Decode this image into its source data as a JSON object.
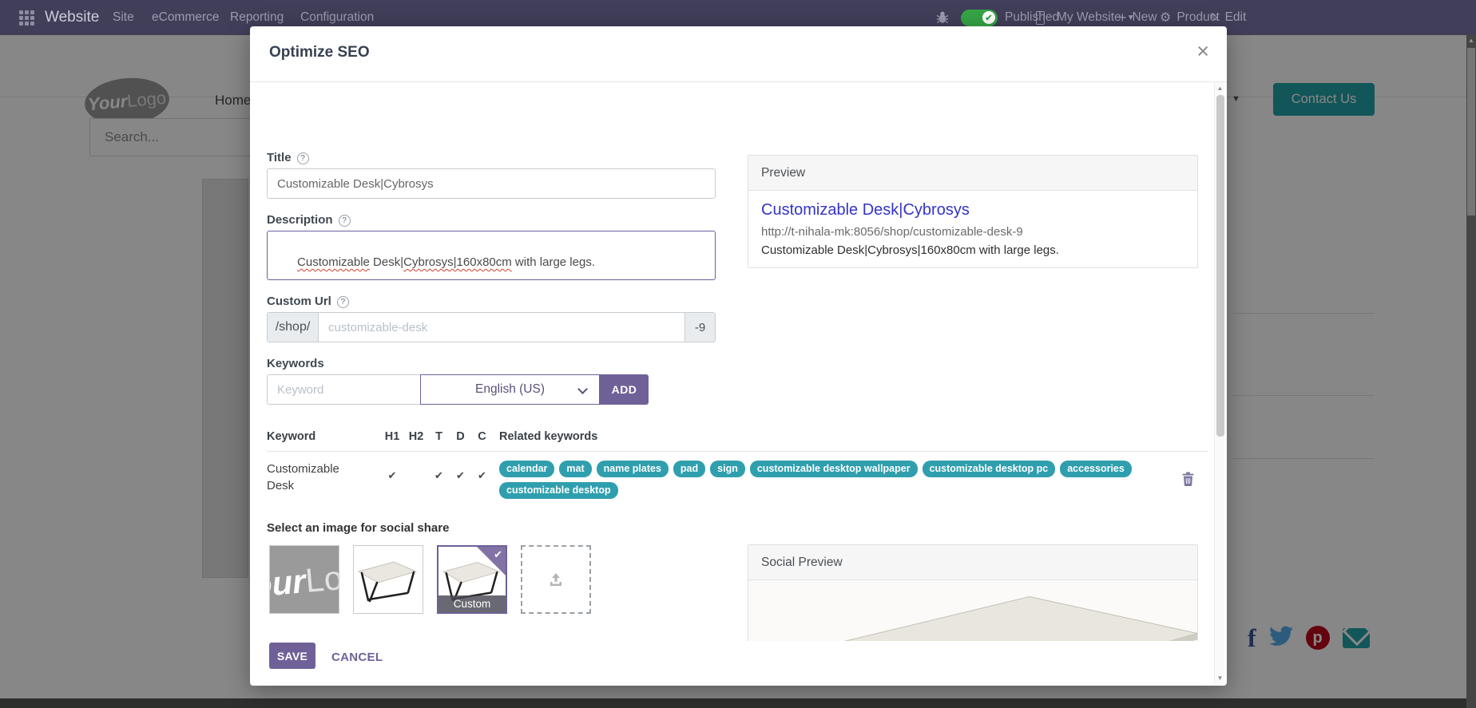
{
  "topbar": {
    "brand": "Website",
    "menus": [
      "Site",
      "eCommerce",
      "Reporting",
      "Configuration"
    ],
    "published_label": "Published",
    "website_selector": "My Website",
    "new_label": "New",
    "product_label": "Product",
    "edit_label": "Edit",
    "plus_glyph": "+",
    "gear_glyph": "⚙",
    "pencil_glyph": "✎",
    "caret_glyph": "▼"
  },
  "page_background": {
    "logo_part1": "Your",
    "logo_part2": "Logo",
    "nav_home": "Home",
    "contact_button": "Contact Us",
    "search_placeholder": "Search...",
    "header_caret": "▼"
  },
  "dialog": {
    "title": "Optimize SEO",
    "close_glyph": "×",
    "fields": {
      "title_label": "Title",
      "title_value": "Customizable Desk|Cybrosys",
      "description_label": "Description",
      "description_parts": [
        "Customizable",
        " Desk|",
        "Cybrosys|160x80cm",
        " with large legs."
      ],
      "custom_url_label": "Custom Url",
      "custom_url_prefix": "/shop/",
      "custom_url_placeholder": "customizable-desk",
      "custom_url_suffix": "-9",
      "keywords_label": "Keywords",
      "keyword_placeholder": "Keyword",
      "language_selected": "English (US)",
      "add_button": "ADD",
      "help_glyph": "?"
    },
    "keyword_table": {
      "headers": [
        "Keyword",
        "H1",
        "H2",
        "T",
        "D",
        "C",
        "Related keywords"
      ],
      "rows": [
        {
          "keyword": "Customizable Desk",
          "checks": [
            "✔",
            "",
            "✔",
            "✔",
            "✔"
          ],
          "related": [
            "calendar",
            "mat",
            "name plates",
            "pad",
            "sign",
            "customizable desktop wallpaper",
            "customizable desktop pc",
            "accessories",
            "customizable desktop"
          ]
        }
      ]
    },
    "social_share_label": "Select an image for social share",
    "custom_image_label": "Custom",
    "selected_check_glyph": "✔",
    "preview_card": {
      "header": "Preview",
      "link": "Customizable Desk|Cybrosys",
      "url": "http://t-nihala-mk:8056/shop/customizable-desk-9",
      "description": "Customizable Desk|Cybrosys|160x80cm with large legs."
    },
    "social_preview_card": {
      "header": "Social Preview"
    },
    "save_button": "SAVE",
    "cancel_button": "CANCEL"
  },
  "colors": {
    "topbar_bg": "#413e5a",
    "accent_purple": "#6f6198",
    "badge_teal": "#2f9fae",
    "published_green": "#36a546",
    "contact_teal": "#23a2a8",
    "preview_link_blue": "#3434c8"
  }
}
